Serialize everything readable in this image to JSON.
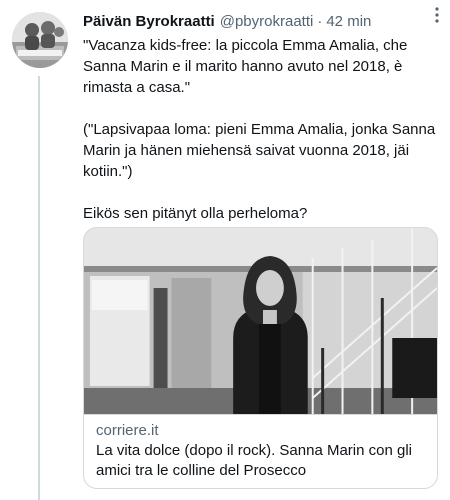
{
  "tweet": {
    "display_name": "Päivän Byrokraatti",
    "handle": "@pbyrokraatti",
    "separator": "·",
    "time": "42 min",
    "paragraphs": [
      "\"Vacanza kids-free: la piccola Emma Amalia, che Sanna Marin e il marito hanno avuto nel 2018, è rimasta a casa.\"",
      "(\"Lapsivapaa loma: pieni Emma Amalia, jonka Sanna Marin ja hänen miehensä saivat vuonna 2018, jäi kotiin.\")",
      "Eikös sen pitänyt olla perheloma?"
    ]
  },
  "card": {
    "domain": "corriere.it",
    "title": "La vita dolce (dopo il rock). Sanna Marin con gli amici tra le colline del Prosecco"
  },
  "icons": {
    "more": "more-vertical-icon"
  }
}
